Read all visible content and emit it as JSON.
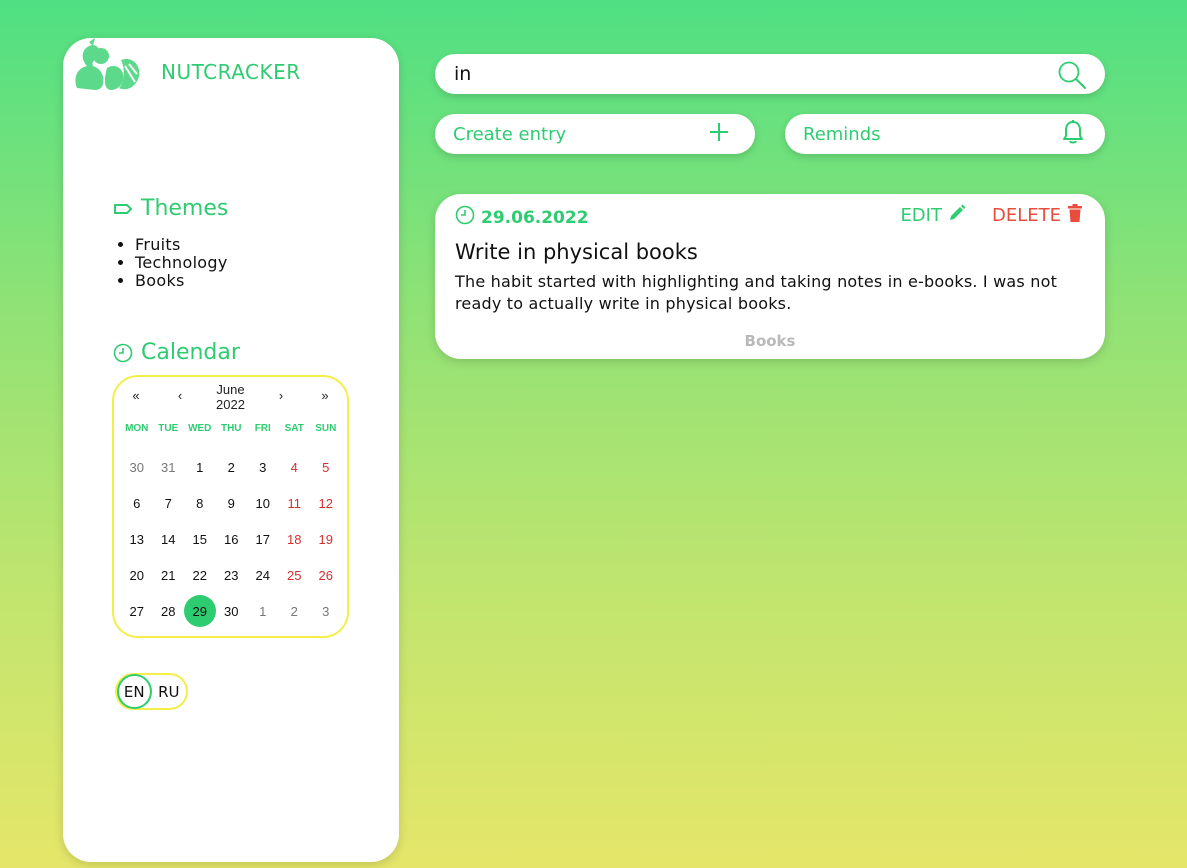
{
  "brand": {
    "name": "NUTCRACKER",
    "logo_icon": "squirrel-icon"
  },
  "themes": {
    "title": "Themes",
    "items": [
      "Fruits",
      "Technology",
      "Books"
    ]
  },
  "calendar": {
    "title": "Calendar",
    "nav": {
      "prev_year": "«",
      "prev_month": "‹",
      "next_month": "›",
      "next_year": "»"
    },
    "month": "June",
    "year": "2022",
    "weekdays": [
      "MON",
      "TUE",
      "WED",
      "THU",
      "FRI",
      "SAT",
      "SUN"
    ],
    "weeks": [
      [
        "30",
        "31",
        "1",
        "2",
        "3",
        "4",
        "5"
      ],
      [
        "6",
        "7",
        "8",
        "9",
        "10",
        "11",
        "12"
      ],
      [
        "13",
        "14",
        "15",
        "16",
        "17",
        "18",
        "19"
      ],
      [
        "20",
        "21",
        "22",
        "23",
        "24",
        "25",
        "26"
      ],
      [
        "27",
        "28",
        "29",
        "30",
        "1",
        "2",
        "3"
      ]
    ],
    "selected_day": "29"
  },
  "language": {
    "options": [
      "EN",
      "RU"
    ],
    "active": "EN"
  },
  "search": {
    "value": "in",
    "placeholder": ""
  },
  "actions": {
    "create_label": "Create entry",
    "reminds_label": "Reminds"
  },
  "entry": {
    "date": "29.06.2022",
    "edit_label": "EDIT",
    "delete_label": "DELETE",
    "title": "Write in physical books",
    "text": "The habit started with highlighting and taking notes in e-books. I was not ready to actually write in physical books.",
    "tag": "Books"
  },
  "colors": {
    "accent": "#2ecc71",
    "danger": "#e74c3c",
    "weekend": "#d32f2f",
    "calendar_border": "#f3ee4a",
    "bg_top": "#4fe083",
    "bg_bottom": "#e5e669"
  }
}
